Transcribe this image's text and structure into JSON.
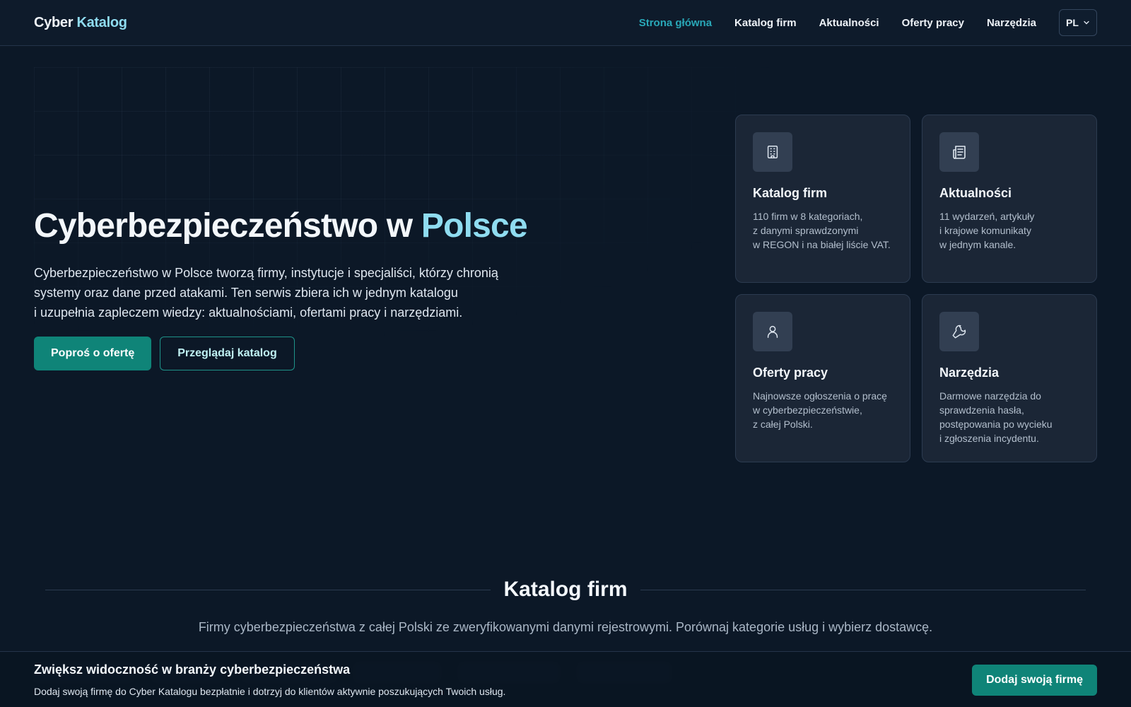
{
  "brand": {
    "part1": "Cyber",
    "part2": "Katalog"
  },
  "nav": {
    "items": [
      {
        "label": "Strona główna",
        "active": true
      },
      {
        "label": "Katalog firm",
        "active": false
      },
      {
        "label": "Aktualności",
        "active": false
      },
      {
        "label": "Oferty pracy",
        "active": false
      },
      {
        "label": "Narzędzia",
        "active": false
      }
    ],
    "language": "PL"
  },
  "hero": {
    "title_main": "Cyberbezpieczeństwo w ",
    "title_accent": "Polsce",
    "description_lines": [
      "Cyberbezpieczeństwo w Polsce tworzą firmy, instytucje i specjaliści, którzy chronią",
      "systemy oraz dane przed atakami. Ten serwis zbiera ich w jednym katalogu",
      "i uzupełnia zapleczem wiedzy: aktualnościami, ofertami pracy i narzędziami."
    ],
    "primary_button": "Poproś o ofertę",
    "secondary_button": "Przeglądaj katalog"
  },
  "cards": [
    {
      "title": "Katalog firm",
      "icon": "building-icon",
      "desc_lines": [
        "110 firm w 8 kategoriach,",
        "z danymi sprawdzonymi",
        "w REGON i na białej liście VAT."
      ]
    },
    {
      "title": "Aktualności",
      "icon": "newspaper-icon",
      "desc_lines": [
        "11 wydarzeń, artykuły",
        "i krajowe komunikaty",
        "w jednym kanale."
      ]
    },
    {
      "title": "Oferty pracy",
      "icon": "user-icon",
      "desc_lines": [
        "Najnowsze ogłoszenia o pracę",
        "w cyberbezpieczeństwie,",
        "z całej Polski."
      ]
    },
    {
      "title": "Narzędzia",
      "icon": "wrench-icon",
      "desc_lines": [
        "Darmowe narzędzia do",
        "sprawdzenia hasła,",
        "postępowania po wycieku",
        "i zgłoszenia incydentu."
      ]
    }
  ],
  "catalog": {
    "title": "Katalog firm",
    "subtitle": "Firmy cyberbezpieczeństwa z całej Polski ze zweryfikowanymi danymi rejestrowymi. Porównaj kategorie usług i wybierz dostawcę."
  },
  "banner": {
    "title": "Zwiększ widoczność w branży cyberbezpieczeństwa",
    "text": "Dodaj swoją firmę do Cyber Katalogu bezpłatnie i dotrzyj do klientów aktywnie poszukujących Twoich usług.",
    "button": "Dodaj swoją firmę"
  },
  "colors": {
    "background": "#0c1827",
    "accent": "#8fdcf0",
    "nav_active": "#29a8b8",
    "primary_button": "#0f8478",
    "card": "#1b2636"
  }
}
